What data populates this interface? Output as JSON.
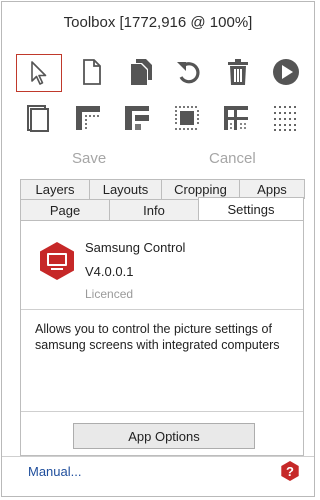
{
  "window": {
    "title": "Toolbox [1772,916 @ 100%]"
  },
  "toolbar": {
    "row1": [
      {
        "icon": "pointer-arrow-icon",
        "selected": true
      },
      {
        "icon": "new-page-icon"
      },
      {
        "icon": "copy-page-icon"
      },
      {
        "icon": "undo-rotate-icon"
      },
      {
        "icon": "trash-icon"
      },
      {
        "icon": "play-icon"
      }
    ],
    "row2": [
      {
        "icon": "page-frame-icon"
      },
      {
        "icon": "layout-top-left-icon"
      },
      {
        "icon": "layout-split-icon"
      },
      {
        "icon": "layout-center-icon"
      },
      {
        "icon": "layout-grid-icon"
      },
      {
        "icon": "dot-grid-icon"
      }
    ]
  },
  "actions": {
    "save_label": "Save",
    "cancel_label": "Cancel"
  },
  "tabs": {
    "top": [
      "Layers",
      "Layouts",
      "Cropping",
      "Apps"
    ],
    "bottom": [
      "Page",
      "Info",
      "Settings"
    ],
    "active": "Settings"
  },
  "app": {
    "name": "Samsung Control",
    "version": "V4.0.0.1",
    "license": "Licenced",
    "description": "Allows you to control the picture settings of samsung screens with integrated computers",
    "options_button": "App Options",
    "icon": "samsung-screen-icon",
    "icon_color": "#c62828"
  },
  "footer": {
    "manual_link": "Manual...",
    "help_icon": "help-icon",
    "help_color": "#c62828"
  },
  "colors": {
    "selection_border": "#c0392b",
    "link": "#1f4e9c",
    "disabled_text": "#a6a6a6"
  }
}
